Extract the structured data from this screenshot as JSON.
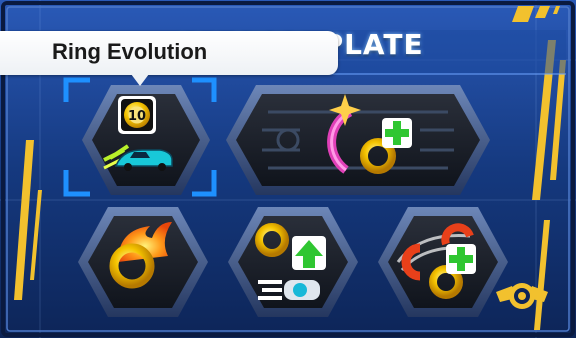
{
  "screen": {
    "title": "MASTER PLATE",
    "tooltip": "Ring Evolution"
  },
  "slots": [
    {
      "id": "ring-evolution",
      "selected": true,
      "badge": "10"
    },
    {
      "id": "add-ring-big",
      "selected": false
    },
    {
      "id": "fire-ring",
      "selected": false
    },
    {
      "id": "ring-boost",
      "selected": false
    },
    {
      "id": "ring-magnet",
      "selected": false
    }
  ],
  "icons": [
    "gold-ring-icon",
    "speed-car-icon",
    "fire-ring-icon",
    "green-plus-icon",
    "green-arrow-up-icon",
    "magnet-icon",
    "emblem-icon"
  ],
  "colors": {
    "background": "#13367a",
    "frame_gold": "#f2c12e",
    "selection": "#1e90ff",
    "ring_gold": "#f5c400",
    "plus_green": "#2fc631"
  }
}
